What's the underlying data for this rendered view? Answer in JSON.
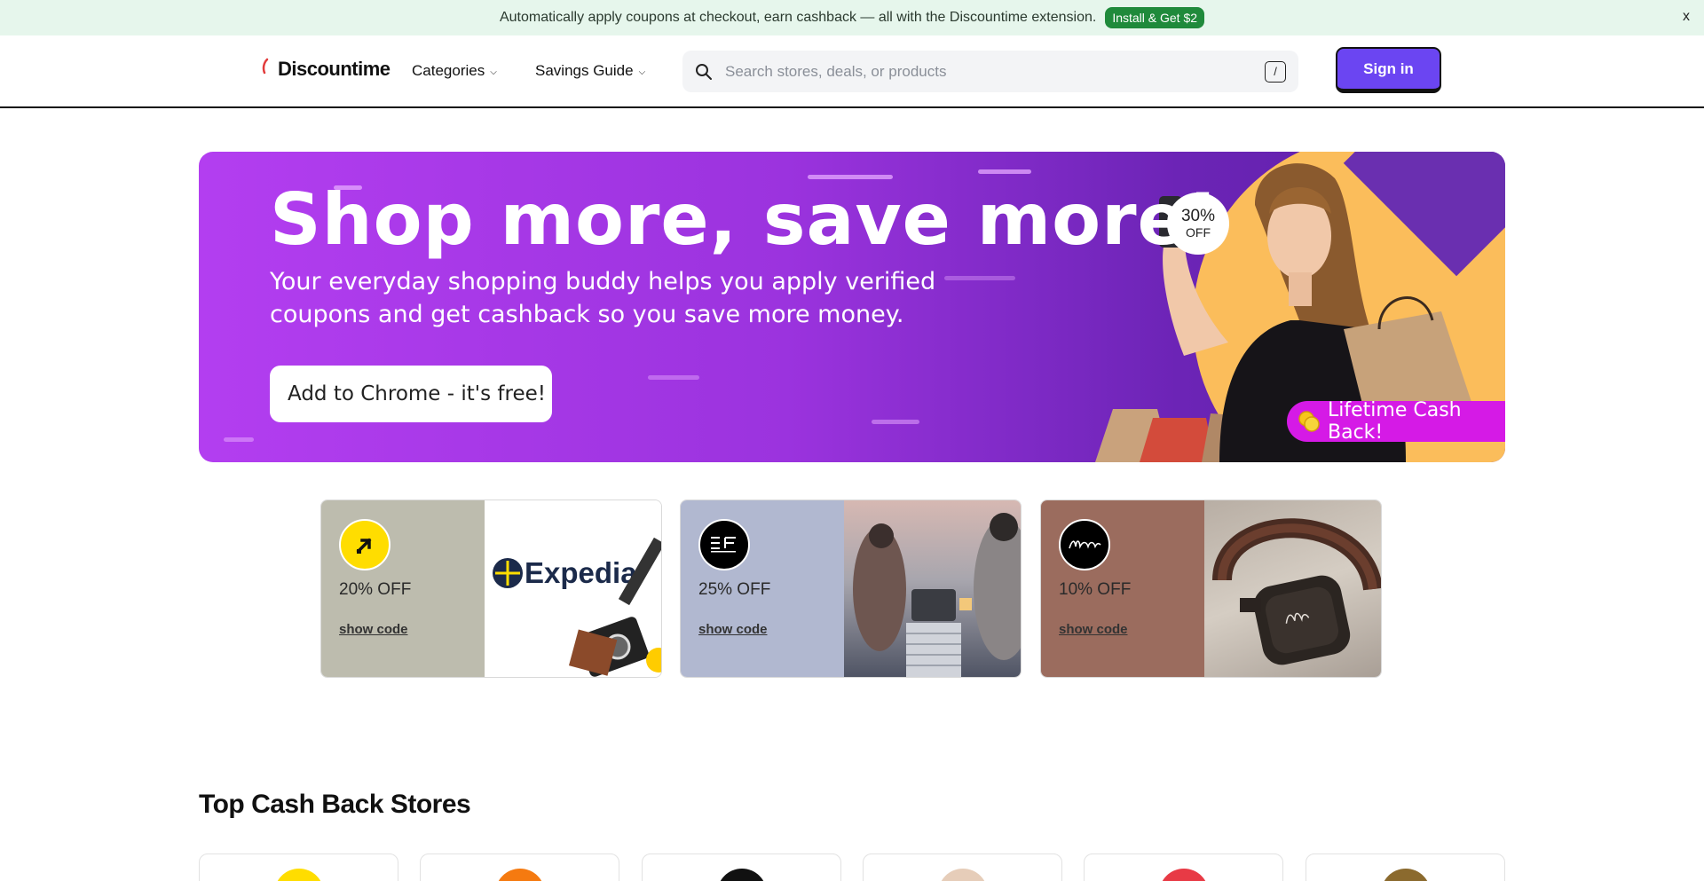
{
  "promo": {
    "message": "Automatically apply coupons at checkout, earn cashback — all with the Discountime extension.",
    "install_label": "Install & Get $2",
    "close_label": "x"
  },
  "header": {
    "logo_text": "Discountime",
    "nav": [
      {
        "label": "Categories"
      },
      {
        "label": "Savings Guide"
      }
    ],
    "search": {
      "placeholder": "Search stores, deals, or products",
      "shortcut": "/"
    },
    "signin_label": "Sign in"
  },
  "hero": {
    "title": "Shop more, save more!",
    "subtitle": "Your everyday shopping buddy helps you apply verified coupons and get cashback so you save more money.",
    "cta_label": "Add to Chrome - it's free!",
    "badge_percent": "30%",
    "badge_off": "OFF",
    "cashback_label": "Lifetime Cash Back!"
  },
  "deals": [
    {
      "discount": "20% OFF",
      "code_label": "show code",
      "bg": "#bdbcae",
      "logo_bg": "#ffdd00",
      "brand_text": "Expedia"
    },
    {
      "discount": "25% OFF",
      "code_label": "show code",
      "bg": "#b1b8d0",
      "logo_bg": "#000000"
    },
    {
      "discount": "10% OFF",
      "code_label": "show code",
      "bg": "#9b6c5e",
      "logo_bg": "#000000"
    }
  ],
  "stores_section": {
    "title": "Top Cash Back Stores",
    "stores": [
      {
        "color": "#ffdd00"
      },
      {
        "color": "#f57a10"
      },
      {
        "color": "#111111"
      },
      {
        "color": "#e6cdb9"
      },
      {
        "color": "#e83a45"
      },
      {
        "color": "#8b6a2e"
      }
    ]
  },
  "colors": {
    "accent": "#6b45f2",
    "promo_bg": "#e6f6ec",
    "install_green": "#1f8a3b",
    "hero_purple": "#b33ef0",
    "cashback_pink": "#d51ae6"
  }
}
